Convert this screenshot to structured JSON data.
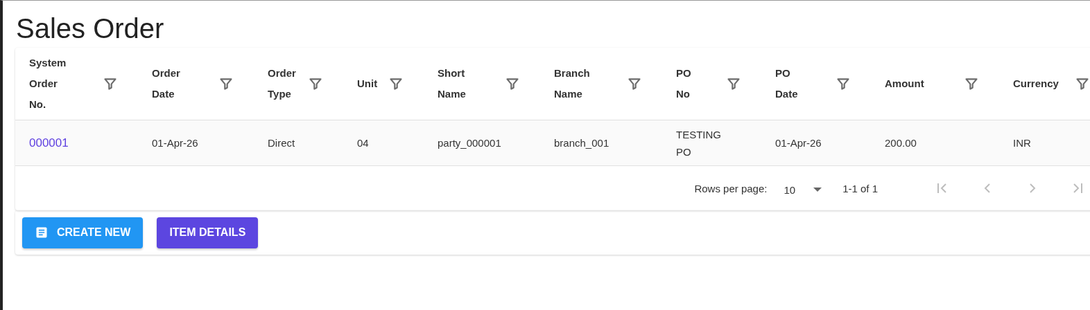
{
  "page_title": "Sales Order",
  "table": {
    "columns": [
      {
        "label": "System Order No.",
        "filter": true
      },
      {
        "label": "Order Date",
        "filter": true
      },
      {
        "label": "Order Type",
        "filter": true
      },
      {
        "label": "Unit",
        "filter": true
      },
      {
        "label": "Short Name",
        "filter": true
      },
      {
        "label": "Branch Name",
        "filter": true
      },
      {
        "label": "PO No",
        "filter": true
      },
      {
        "label": "PO Date",
        "filter": true
      },
      {
        "label": "Amount",
        "filter": true
      },
      {
        "label": "Currency",
        "filter": true
      }
    ],
    "rows": [
      {
        "cells": [
          {
            "text": "000001",
            "kind": "link"
          },
          {
            "text": "01-Apr-26",
            "kind": "text"
          },
          {
            "text": "Direct",
            "kind": "text"
          },
          {
            "text": "04",
            "kind": "text"
          },
          {
            "text": "party_000001",
            "kind": "text"
          },
          {
            "text": "branch_001",
            "kind": "text"
          },
          {
            "text": "TESTING PO",
            "kind": "text"
          },
          {
            "text": "01-Apr-26",
            "kind": "text"
          },
          {
            "text": "200.00",
            "kind": "text"
          },
          {
            "text": "INR",
            "kind": "text"
          }
        ]
      }
    ]
  },
  "pagination": {
    "rows_per_page_label": "Rows per page:",
    "rows_per_page": "10",
    "range": "1-1 of 1"
  },
  "buttons": [
    {
      "label": "CREATE NEW",
      "kind": "primary",
      "icon": true
    },
    {
      "label": "ITEM DETAILS",
      "kind": "secondary",
      "icon": false
    }
  ]
}
